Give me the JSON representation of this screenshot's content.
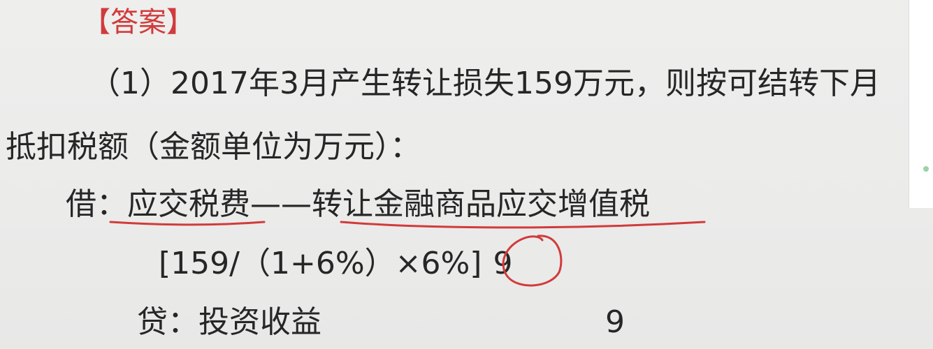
{
  "answer_heading": "【答案】",
  "paragraph": {
    "line1": "（1）2017年3月产生转让损失159万元，则按可结转下月",
    "line2": "抵扣税额（金额单位为万元）："
  },
  "debit": {
    "label": "借：",
    "account_main": "应交税费",
    "dash": "——",
    "account_sub": "转让金融商品应交增值税"
  },
  "formula": {
    "expression": "[159/（1+6%）×6%]",
    "value": "9"
  },
  "credit": {
    "label": "贷：投资收益",
    "amount": "9"
  },
  "colors": {
    "accent": "#d13b3b",
    "text": "#262626",
    "background": "#ebebea"
  }
}
